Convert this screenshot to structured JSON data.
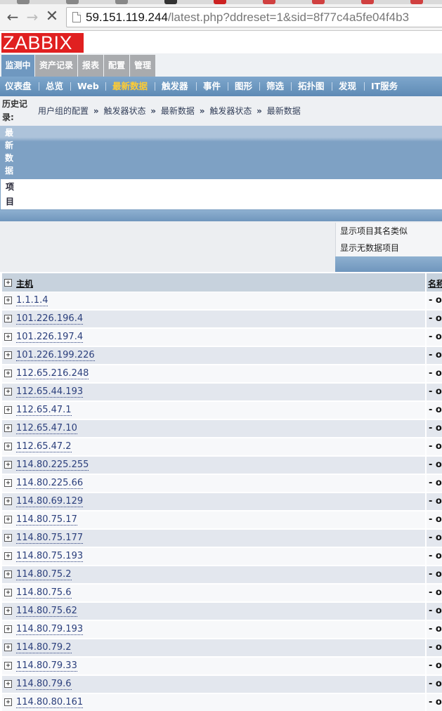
{
  "browser": {
    "url_host": "59.151.119.244",
    "url_rest": "/latest.php?ddreset=1&sid=8f77c4a5fe04f4b3",
    "tab_colors": [
      "#888888",
      "#888888",
      "#888888",
      "#333333",
      "#cc2222",
      "#d04040",
      "#d04040",
      "#d04040",
      "#d04040"
    ]
  },
  "header": {
    "logo": "ZABBIX"
  },
  "main_menu": [
    {
      "label": "监测中",
      "active": true
    },
    {
      "label": "资产记录",
      "active": false
    },
    {
      "label": "报表",
      "active": false
    },
    {
      "label": "配置",
      "active": false
    },
    {
      "label": "管理",
      "active": false
    }
  ],
  "sub_menu": [
    {
      "label": "仪表盘"
    },
    {
      "label": "总览"
    },
    {
      "label": "Web"
    },
    {
      "label": "最新数据",
      "current": true
    },
    {
      "label": "触发器"
    },
    {
      "label": "事件"
    },
    {
      "label": "图形"
    },
    {
      "label": "筛选"
    },
    {
      "label": "拓扑图"
    },
    {
      "label": "发现"
    },
    {
      "label": "IT服务"
    }
  ],
  "history": {
    "label": "历史记录:",
    "crumbs": [
      "用户组的配置",
      "触发器状态",
      "最新数据",
      "触发器状态",
      "最新数据"
    ],
    "arrow": "»"
  },
  "page": {
    "title": "最新数据",
    "items_label": "项目"
  },
  "filter_options": {
    "show_similar": "显示项目其名类似",
    "show_no_data": "显示无数据项目"
  },
  "table": {
    "expander": "+",
    "columns": {
      "host": "主机",
      "name": "名称"
    },
    "rows": [
      {
        "host": "1.1.1.4",
        "name": "- ot"
      },
      {
        "host": "101.226.196.4",
        "name": "- ot"
      },
      {
        "host": "101.226.197.4",
        "name": "- ot"
      },
      {
        "host": "101.226.199.226",
        "name": "- ot"
      },
      {
        "host": "112.65.216.248",
        "name": "- ot"
      },
      {
        "host": "112.65.44.193",
        "name": "- ot"
      },
      {
        "host": "112.65.47.1",
        "name": "- ot"
      },
      {
        "host": "112.65.47.10",
        "name": "- ot"
      },
      {
        "host": "112.65.47.2",
        "name": "- ot"
      },
      {
        "host": "114.80.225.255",
        "name": "- ot"
      },
      {
        "host": "114.80.225.66",
        "name": "- ot"
      },
      {
        "host": "114.80.69.129",
        "name": "- ot"
      },
      {
        "host": "114.80.75.17",
        "name": "- ot"
      },
      {
        "host": "114.80.75.177",
        "name": "- ot"
      },
      {
        "host": "114.80.75.193",
        "name": "- ot"
      },
      {
        "host": "114.80.75.2",
        "name": "- ot"
      },
      {
        "host": "114.80.75.6",
        "name": "- ot"
      },
      {
        "host": "114.80.75.62",
        "name": "- ot"
      },
      {
        "host": "114.80.79.193",
        "name": "- ot"
      },
      {
        "host": "114.80.79.2",
        "name": "- ot"
      },
      {
        "host": "114.80.79.33",
        "name": "- ot"
      },
      {
        "host": "114.80.79.6",
        "name": "- ot"
      },
      {
        "host": "114.80.80.161",
        "name": "- ot"
      }
    ]
  }
}
